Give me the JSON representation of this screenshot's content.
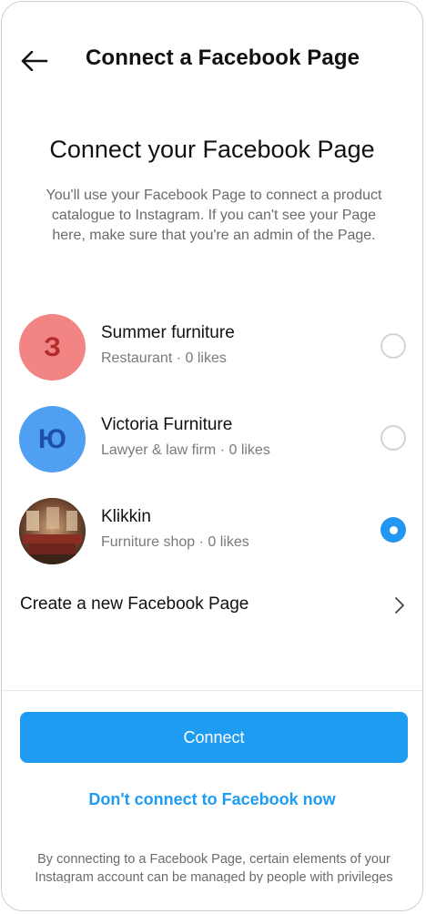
{
  "header": {
    "title": "Connect a Facebook Page",
    "back_icon": "arrow-left-icon"
  },
  "main": {
    "title": "Connect your Facebook Page",
    "description": "You'll use your Facebook Page to connect a product catalogue to Instagram. If you can't see your Page here, make sure that you're an admin of the Page."
  },
  "pages": [
    {
      "name": "Summer furniture",
      "meta": "Restaurant · 0 likes",
      "avatar_letter": "З",
      "avatar_color": "#f28484",
      "selected": false
    },
    {
      "name": "Victoria Furniture",
      "meta": "Lawyer & law firm · 0 likes",
      "avatar_letter": "Ю",
      "avatar_color": "#4f9ff2",
      "selected": false
    },
    {
      "name": "Klikkin",
      "meta": "Furniture shop · 0 likes",
      "avatar_letter": "",
      "avatar_color": "#5a3a2a",
      "selected": true
    }
  ],
  "create": {
    "label": "Create a new Facebook Page",
    "icon": "chevron-right-icon"
  },
  "actions": {
    "connect_label": "Connect",
    "skip_label": "Don't connect to Facebook now"
  },
  "footer": {
    "text": "By connecting to a Facebook Page, certain elements of your Instagram account can be managed by people with privileges"
  },
  "colors": {
    "accent": "#1e9cf2",
    "text": "#111111",
    "muted": "#6b6b6b"
  }
}
